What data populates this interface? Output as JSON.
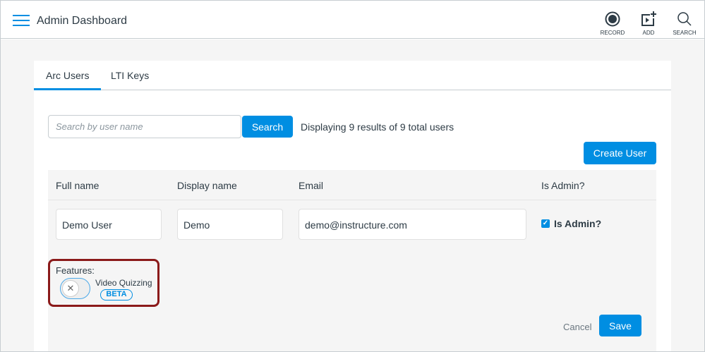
{
  "header": {
    "title": "Admin Dashboard",
    "tools": [
      {
        "label": "RECORD"
      },
      {
        "label": "ADD"
      },
      {
        "label": "SEARCH"
      }
    ]
  },
  "tabs": [
    {
      "label": "Arc Users"
    },
    {
      "label": "LTI Keys"
    }
  ],
  "search": {
    "placeholder": "Search by user name",
    "value": "",
    "button": "Search"
  },
  "result_text": "Displaying 9 results of 9 total users",
  "create_user": "Create User",
  "table": {
    "headers": [
      "Full name",
      "Display name",
      "Email",
      "Is Admin?"
    ],
    "row": {
      "full_name": "Demo User",
      "display_name": "Demo",
      "email": "demo@instructure.com",
      "is_admin_label": "Is Admin?",
      "is_admin": true
    }
  },
  "features": {
    "label": "Features:",
    "video_quizzing": "Video Quizzing",
    "badge": "BETA",
    "enabled": false
  },
  "actions": {
    "cancel": "Cancel",
    "save": "Save"
  },
  "colors": {
    "accent": "#008ee2",
    "highlight": "#8b1a1a"
  }
}
